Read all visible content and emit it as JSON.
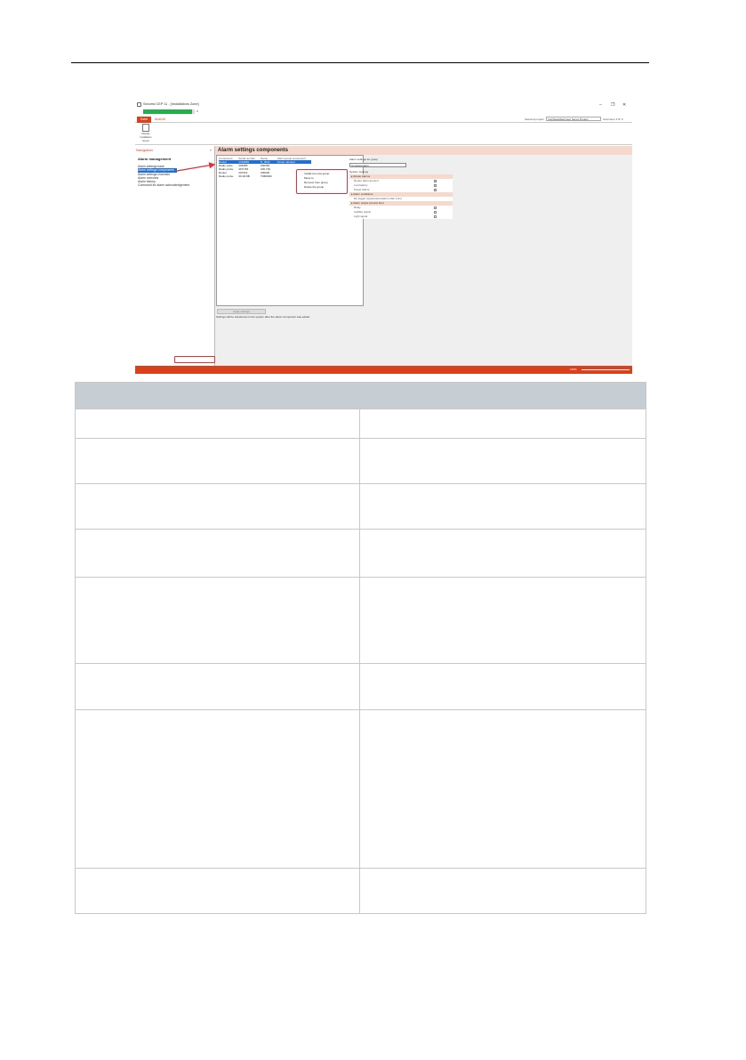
{
  "window": {
    "title": "Secvest CEP 11 - [Installations Zone]",
    "progress_fraction": 0.95,
    "close_progress": "x",
    "controls": [
      "–",
      "❐",
      "✕"
    ]
  },
  "menu": {
    "file": "Datei",
    "help": "Ansicht",
    "project_label": "Selected project:",
    "project_value": "Instr/Seat/Alarmsec Servix Project",
    "user_label": "Username  ▾  ⚙  ✕"
  },
  "ribbon": {
    "button_label": "Display installation layout"
  },
  "navigation": {
    "header": "Navigation",
    "collapse": "«",
    "title": "Alarm management",
    "items": [
      {
        "label": "Alarm settings base",
        "active": false
      },
      {
        "label": "Alarm settings components",
        "active": true
      },
      {
        "label": "Alarm settings channels",
        "active": false
      },
      {
        "label": "Alarm overview",
        "active": false
      },
      {
        "label": "Alarm history",
        "active": false
      },
      {
        "label": "Command for alarm acknowledgement",
        "active": false
      }
    ]
  },
  "main": {
    "title": "Alarm settings components",
    "columns": [
      "Component",
      "Serial number",
      "Name",
      "Alarm group component"
    ],
    "rows": [
      {
        "type": "Router",
        "serial": "1423083",
        "name": "R_0034",
        "group": "Group name(s)",
        "selected": true
      },
      {
        "type": "Radio valve",
        "serial": "296385",
        "name": "Z00363",
        "group": "",
        "selected": false
      },
      {
        "type": "Radio probe",
        "serial": "297/153",
        "name": "Z20 153",
        "group": "",
        "selected": false
      },
      {
        "type": "Router",
        "serial": "297201",
        "name": "Z00020",
        "group": "",
        "selected": false
      },
      {
        "type": "Radio probe",
        "serial": "00-00-8B",
        "name": "TDB0000",
        "group": "",
        "selected": false
      }
    ],
    "context_menu": [
      "Install into new group",
      "Move to",
      "Remove from group",
      "Delete the group"
    ],
    "setup_button": "Apply settings",
    "setup_note": "Settings will be transferred to the system after the alarm component was edited"
  },
  "settings": {
    "group_label": "Alarm settings for group",
    "group_value": "Componentgr1",
    "system_label": "System settings",
    "sections": [
      {
        "title": "▸ Router alarms",
        "rows": [
          {
            "label": "Router disconnected",
            "checked": true
          },
          {
            "label": "Low battery",
            "checked": true
          },
          {
            "label": "Power failure",
            "checked": true
          }
        ]
      },
      {
        "title": "▸ Alarm conditions",
        "rows": [
          {
            "label": "Re-trigger suppressed alarms after [min]",
            "checked": null
          }
        ]
      },
      {
        "title": "▸ Alarm output (control box)",
        "rows": [
          {
            "label": "Relay",
            "checked": false
          },
          {
            "label": "Audible signal",
            "checked": false
          },
          {
            "label": "Light signal",
            "checked": false
          }
        ]
      }
    ]
  },
  "statusbar": {
    "zoom": "100%"
  },
  "colors": {
    "accent": "#d9401c",
    "selection": "#1e6fd9",
    "highlight_box": "#e0303a",
    "table_header": "#c7ced3"
  },
  "table": {
    "header": "",
    "rows": [
      {
        "left": "",
        "right": ""
      },
      {
        "left": "",
        "right": ""
      },
      {
        "left": "",
        "right": ""
      },
      {
        "left": "",
        "right": ""
      },
      {
        "left": "",
        "right": ""
      },
      {
        "left": "",
        "right": ""
      },
      {
        "left": "",
        "right": ""
      },
      {
        "left": "",
        "right": ""
      }
    ]
  }
}
